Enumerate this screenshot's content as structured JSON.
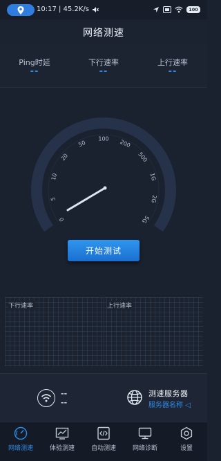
{
  "status_bar": {
    "time_and_speed": "10:17 | 45.2K/s",
    "battery": "100",
    "icons": [
      "location-icon",
      "mute-icon",
      "navigation-icon",
      "sim-icon",
      "wifi-icon",
      "battery-icon"
    ]
  },
  "header": {
    "title": "网络测速"
  },
  "metrics": [
    {
      "label": "Ping时延",
      "value": "--"
    },
    {
      "label": "下行速率",
      "value": "--"
    },
    {
      "label": "上行速率",
      "value": "--"
    }
  ],
  "gauge": {
    "ticks": [
      "0",
      "5",
      "10",
      "20",
      "50",
      "100",
      "200",
      "500",
      "1G",
      "2G",
      "5G"
    ],
    "needle_value": "5"
  },
  "start_button": {
    "label": "开始测试"
  },
  "graph": {
    "download_label": "下行速率",
    "upload_label": "上行速率"
  },
  "info": {
    "network_value_1": "--",
    "network_value_2": "--",
    "server_title": "测速服务器",
    "server_name": "服务器名称",
    "server_arrow": "◁"
  },
  "tabs": [
    {
      "label": "网络测速",
      "icon": "speedometer-icon",
      "active": true
    },
    {
      "label": "体验测速",
      "icon": "chart-icon",
      "active": false
    },
    {
      "label": "自动测速",
      "icon": "code-file-icon",
      "active": false
    },
    {
      "label": "网络诊断",
      "icon": "monitor-icon",
      "active": false
    },
    {
      "label": "设置",
      "icon": "settings-icon",
      "active": false
    }
  ],
  "colors": {
    "accent": "#2f8ae6",
    "background": "#1a2230",
    "gauge_track": "#26324a"
  }
}
